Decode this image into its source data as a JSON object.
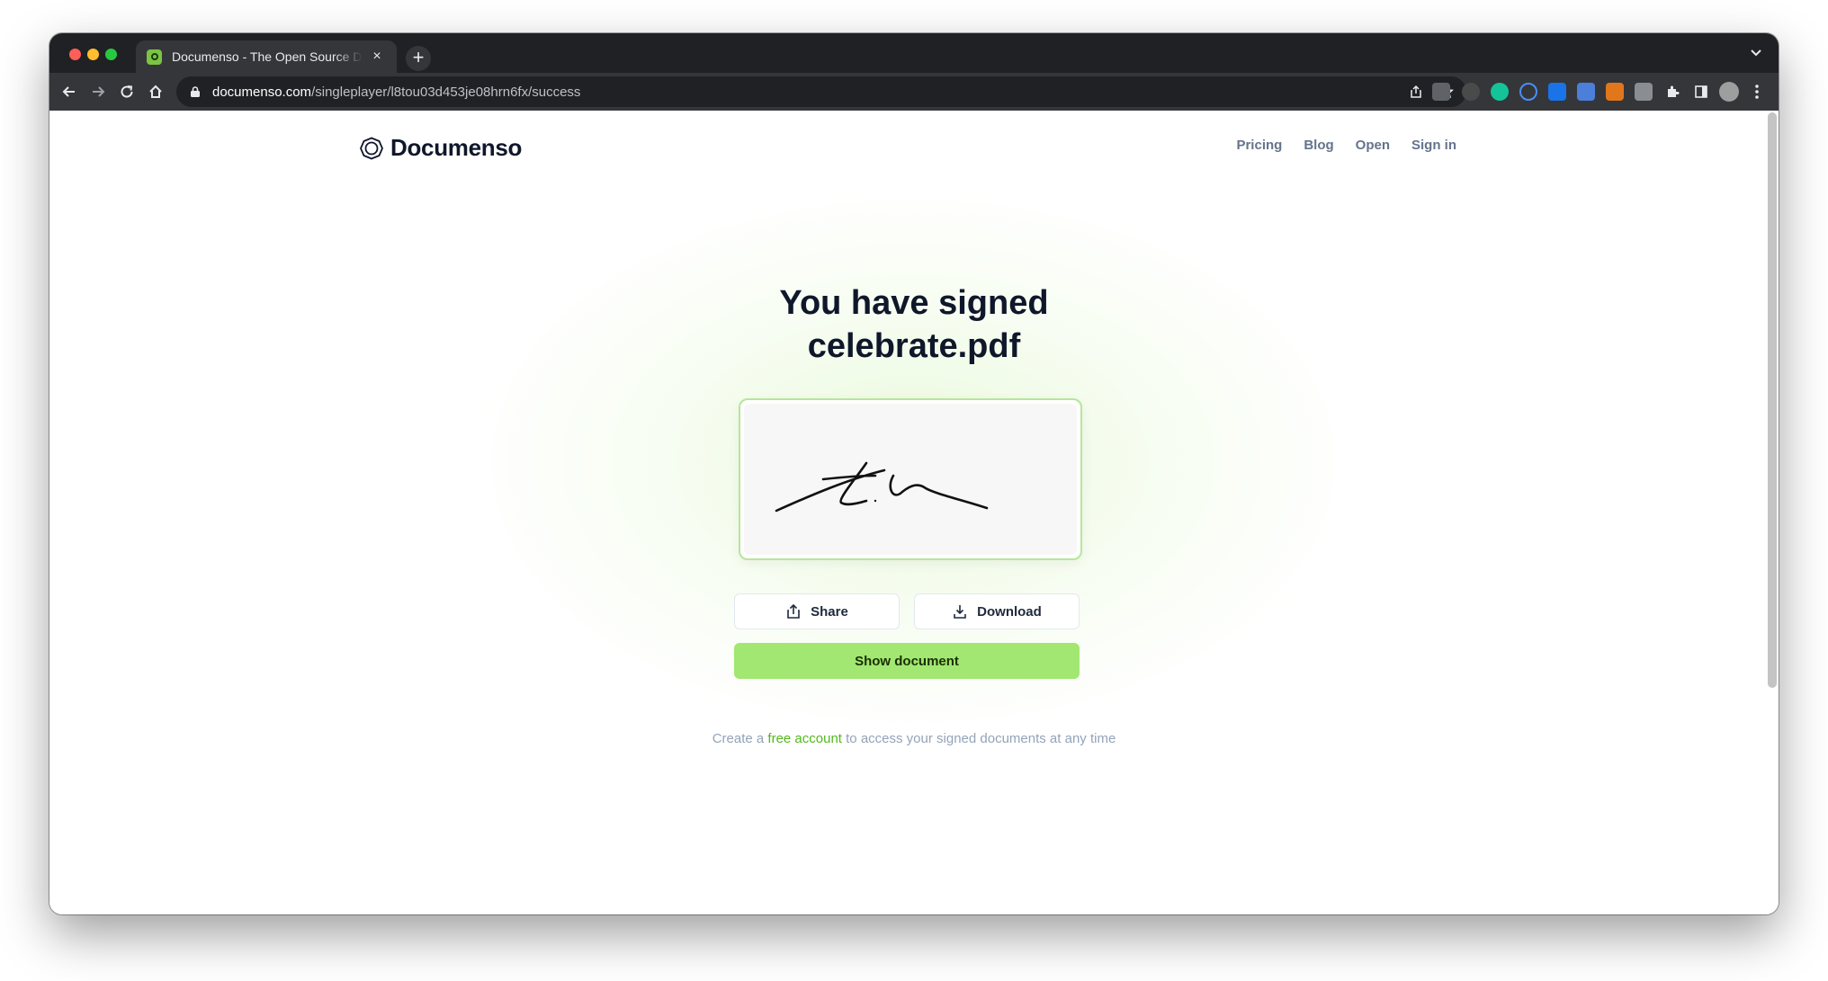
{
  "browser": {
    "tab_title": "Documenso - The Open Source DocuSign Alternative",
    "tab_close": "×",
    "new_tab": "+",
    "url_host": "documenso.com",
    "url_path": "/singleplayer/l8tou03d453je08hrn6fx/success"
  },
  "site": {
    "brand": "Documenso",
    "nav": [
      "Pricing",
      "Blog",
      "Open",
      "Sign in"
    ]
  },
  "main": {
    "heading_line1": "You have signed",
    "heading_line2": "celebrate.pdf",
    "share_label": "Share",
    "download_label": "Download",
    "show_document_label": "Show document",
    "footnote_prefix": "Create a",
    "footnote_link": "free account",
    "footnote_suffix": "to access your signed documents at any time"
  },
  "colors": {
    "accent": "#a2e771",
    "link": "#52b81c",
    "heading": "#0f172a"
  }
}
